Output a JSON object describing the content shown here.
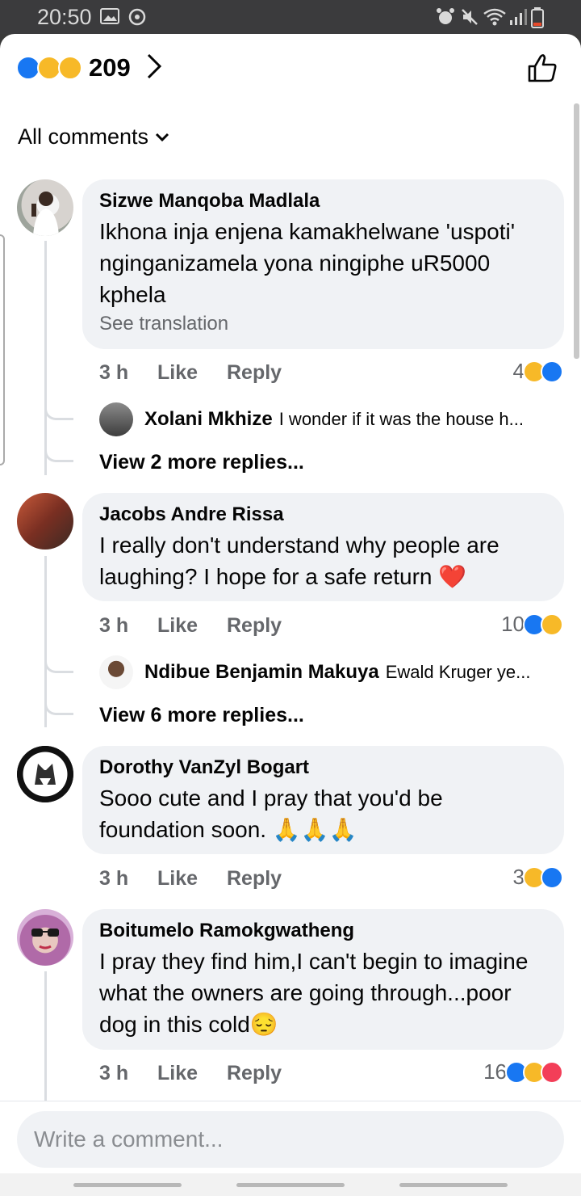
{
  "status_bar": {
    "time": "20:50"
  },
  "header": {
    "reaction_count": "209"
  },
  "sort": {
    "label": "All comments"
  },
  "comments": [
    {
      "name": "Sizwe Manqoba Madlala",
      "text": "Ikhona inja enjena kamakhelwane 'uspoti' nginganizamela yona ningiphe uR5000 kphela",
      "translate": "See translation",
      "time": "3 h",
      "like": "Like",
      "reply": "Reply",
      "reaction_count": "4",
      "reactions": [
        "haha",
        "like"
      ],
      "preview_reply": {
        "name": "Xolani Mkhize",
        "text": "I wonder if it was the house h..."
      },
      "more_replies": "View 2 more replies..."
    },
    {
      "name": "Jacobs Andre Rissa",
      "text": "I really don't understand why people are laughing? I hope for a safe return ❤️",
      "time": "3 h",
      "like": "Like",
      "reply": "Reply",
      "reaction_count": "10",
      "reactions": [
        "like",
        "haha"
      ],
      "preview_reply": {
        "name": "Ndibue Benjamin Makuya",
        "text": "Ewald Kruger ye..."
      },
      "more_replies": "View 6 more replies..."
    },
    {
      "name": "Dorothy VanZyl Bogart",
      "text": "Sooo cute and I pray that you'd be foundation soon. 🙏🙏🙏",
      "time": "3 h",
      "like": "Like",
      "reply": "Reply",
      "reaction_count": "3",
      "reactions": [
        "haha",
        "like"
      ]
    },
    {
      "name": "Boitumelo Ramokgwatheng",
      "text": "I pray they find him,I can't begin to imagine what the owners are going through...poor dog in this cold😔",
      "time": "3 h",
      "like": "Like",
      "reply": "Reply",
      "reaction_count": "16",
      "reactions": [
        "like",
        "haha",
        "love"
      ]
    }
  ],
  "composer": {
    "placeholder": "Write a comment..."
  },
  "colors": {
    "like": "#1877f2",
    "haha": "#f7b928",
    "love": "#f33e58",
    "bubble": "#f0f2f5",
    "muted": "#65676b"
  }
}
